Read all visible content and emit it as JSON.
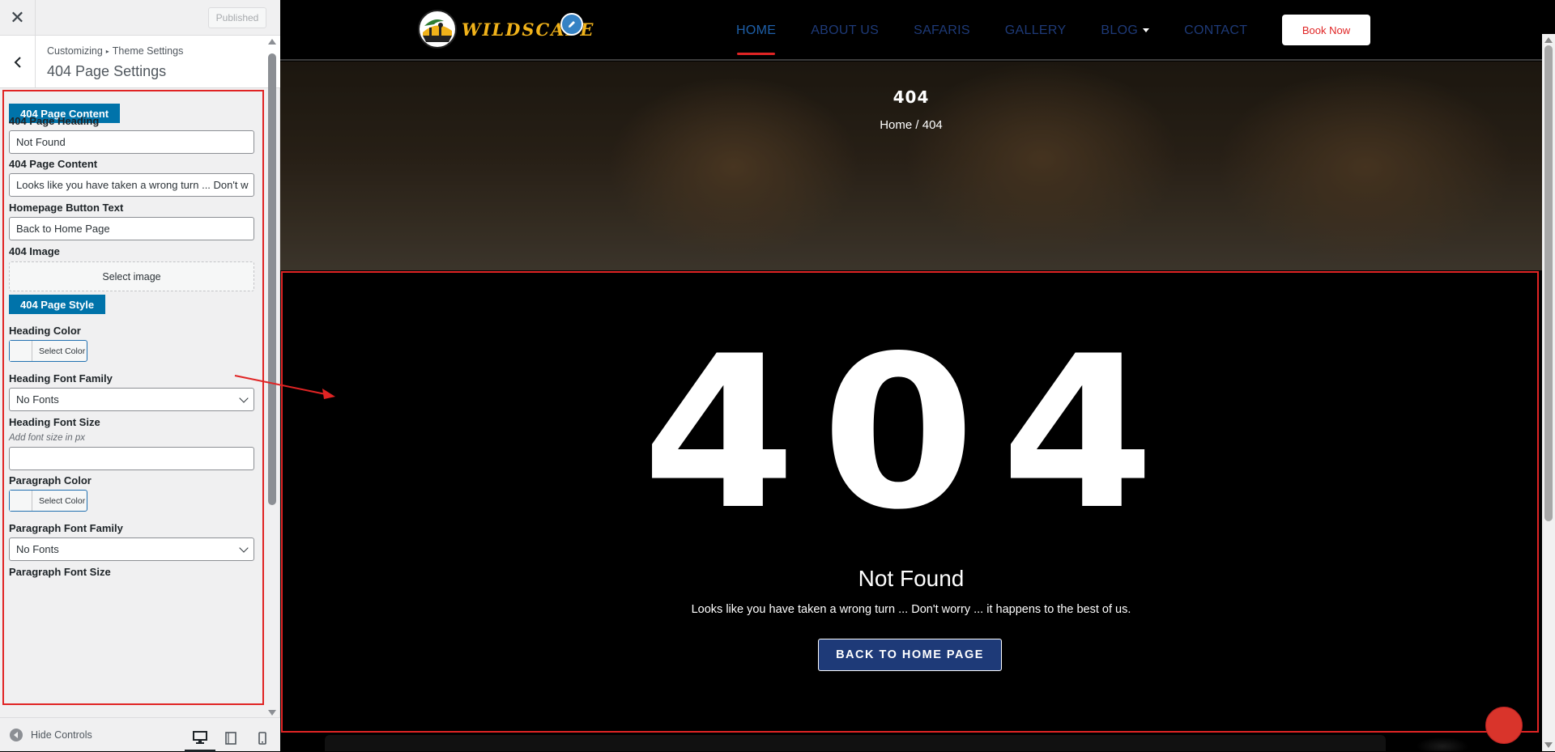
{
  "customizer": {
    "close_icon": "close-icon",
    "published_label": "Published",
    "breadcrumb": {
      "root": "Customizing",
      "parent": "Theme Settings"
    },
    "panel_title": "404 Page Settings",
    "sections": {
      "content_label": "404 Page Content",
      "style_label": "404 Page Style"
    },
    "controls": {
      "heading": {
        "label": "404 Page Heading",
        "value": "Not Found"
      },
      "content": {
        "label": "404 Page Content",
        "value": "Looks like you have taken a wrong turn ... Don't w"
      },
      "button_text": {
        "label": "Homepage Button Text",
        "value": "Back to Home Page"
      },
      "image": {
        "label": "404 Image",
        "button": "Select image"
      },
      "heading_color": {
        "label": "Heading Color",
        "button": "Select Color"
      },
      "heading_font_family": {
        "label": "Heading Font Family",
        "value": "No Fonts"
      },
      "heading_font_size": {
        "label": "Heading Font Size",
        "description": "Add font size in px",
        "value": ""
      },
      "paragraph_color": {
        "label": "Paragraph Color",
        "button": "Select Color"
      },
      "paragraph_font_family": {
        "label": "Paragraph Font Family",
        "value": "No Fonts"
      },
      "paragraph_font_size": {
        "label": "Paragraph Font Size"
      }
    },
    "footer": {
      "hide_controls": "Hide Controls"
    }
  },
  "site": {
    "logo_text": "WILDSCAPE",
    "nav": [
      "HOME",
      "ABOUT US",
      "SAFARIS",
      "GALLERY",
      "BLOG",
      "CONTACT"
    ],
    "active_nav": "HOME",
    "book_now": "Book Now",
    "hero": {
      "title": "404",
      "breadcrumb": "Home / 404"
    },
    "not_found": {
      "big_text": "404",
      "heading": "Not Found",
      "content": "Looks like you have taken a wrong turn ... Don't worry ... it happens to the best of us.",
      "button": "BACK TO HOME PAGE"
    }
  },
  "colors": {
    "section_button": "#0073aa",
    "annotation_red": "#e02424",
    "nav_text": "#1e3a78",
    "logo_gold": "#f0b21a",
    "home_button_bg": "#1e3a78"
  }
}
